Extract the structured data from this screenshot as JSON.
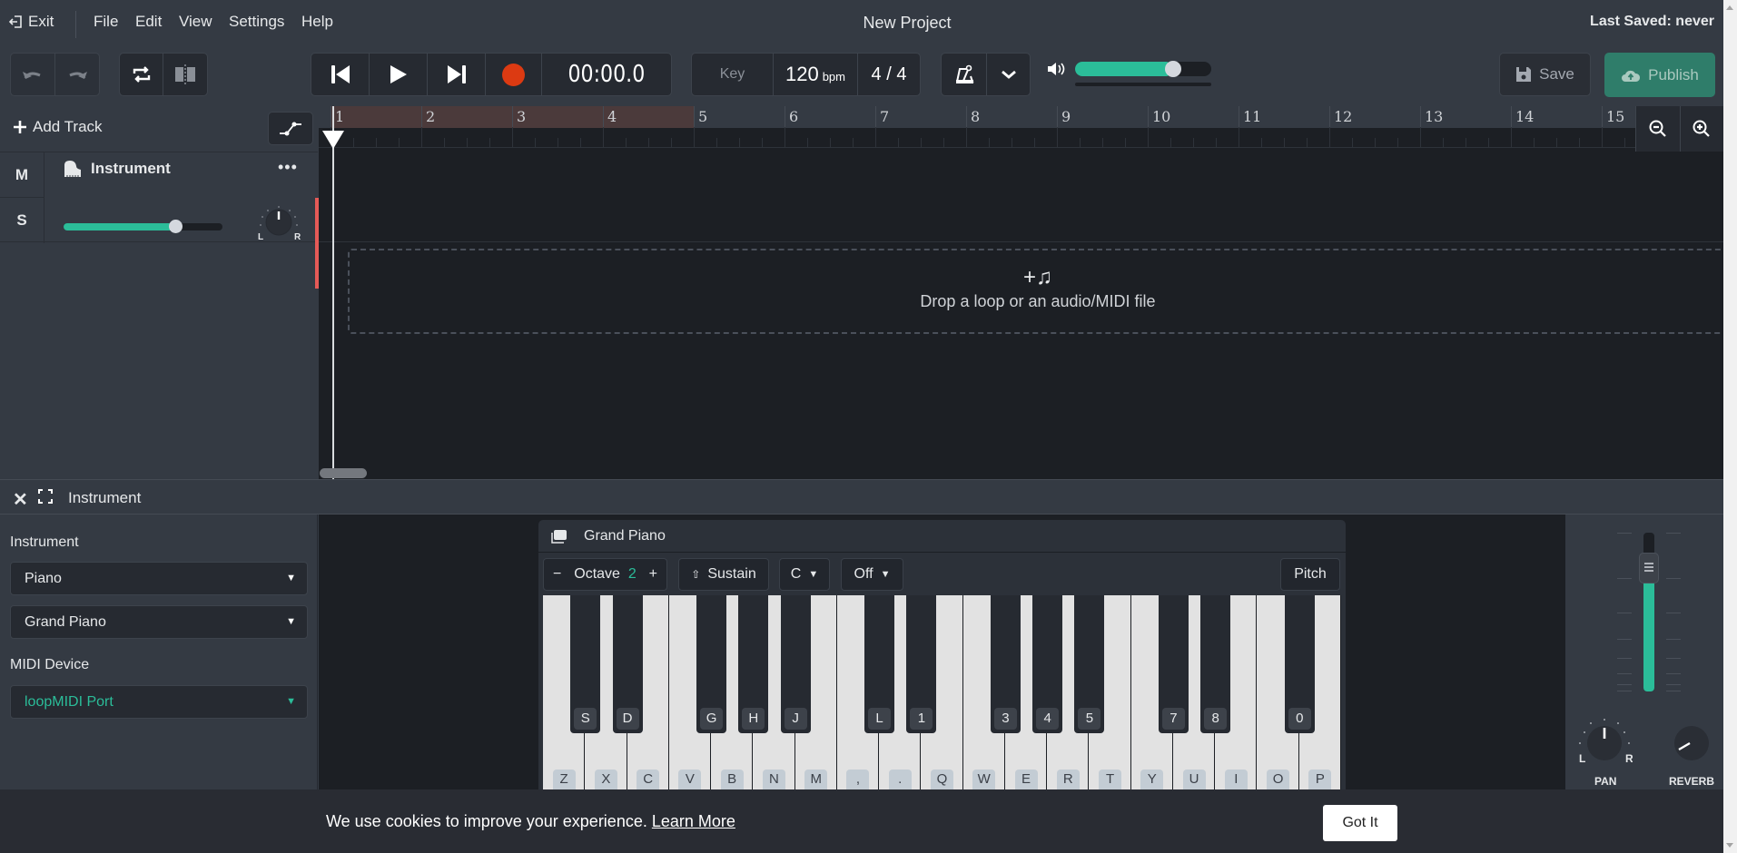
{
  "menu": {
    "exit_label": "Exit",
    "items": [
      "File",
      "Edit",
      "View",
      "Settings",
      "Help"
    ]
  },
  "header": {
    "title": "New Project",
    "last_saved": "Last Saved: never"
  },
  "transport": {
    "timecode": "00:00.0",
    "key_label": "Key",
    "bpm": "120",
    "bpm_unit": "bpm",
    "time_signature": "4 / 4",
    "master_volume": 0.72
  },
  "actions": {
    "save_label": "Save",
    "publish_label": "Publish"
  },
  "tracks_panel": {
    "add_track_label": "Add Track",
    "tracks": [
      {
        "name": "Instrument",
        "mute_label": "M",
        "solo_label": "S",
        "volume": 0.7,
        "pan_l": "L",
        "pan_r": "R"
      }
    ]
  },
  "timeline": {
    "bars": [
      "1",
      "2",
      "3",
      "4",
      "5",
      "6",
      "7",
      "8",
      "9",
      "10",
      "11",
      "12",
      "13",
      "14",
      "15"
    ],
    "loop_range": [
      1,
      4
    ],
    "drop_zone_text": "Drop a loop or an audio/MIDI file"
  },
  "instrument_panel": {
    "title": "Instrument",
    "instrument_label": "Instrument",
    "category_value": "Piano",
    "preset_value": "Grand Piano",
    "midi_label": "MIDI Device",
    "midi_value": "loopMIDI Port"
  },
  "piano": {
    "title": "Grand Piano",
    "octave_label": "Octave",
    "octave_value": "2",
    "octave_minus": "−",
    "octave_plus": "+",
    "sustain_label": "Sustain",
    "key_value": "C",
    "scale_value": "Off",
    "pitch_label": "Pitch",
    "white_keys": [
      "Z",
      "X",
      "C",
      "V",
      "B",
      "N",
      "M",
      ",",
      ".",
      "Q",
      "W",
      "E",
      "R",
      "T",
      "Y",
      "U",
      "I",
      "O",
      "P"
    ],
    "black_keys": [
      {
        "label": "S",
        "after": 0
      },
      {
        "label": "D",
        "after": 1
      },
      {
        "label": "G",
        "after": 3
      },
      {
        "label": "H",
        "after": 4
      },
      {
        "label": "J",
        "after": 5
      },
      {
        "label": "L",
        "after": 7
      },
      {
        "label": "1",
        "after": 8
      },
      {
        "label": "3",
        "after": 10
      },
      {
        "label": "4",
        "after": 11
      },
      {
        "label": "5",
        "after": 12
      },
      {
        "label": "7",
        "after": 14
      },
      {
        "label": "8",
        "after": 15
      },
      {
        "label": "0",
        "after": 17
      }
    ]
  },
  "mixer": {
    "fader_level": 0.78,
    "pan_label": "PAN",
    "pan_l": "L",
    "pan_r": "R",
    "reverb_label": "REVERB"
  },
  "cookie": {
    "message": "We use cookies to improve your experience.",
    "learn_more": "Learn More",
    "accept_label": "Got It"
  },
  "colors": {
    "accent": "#2bbd99",
    "record": "#dc3a12",
    "loop_region": "#4b3a3b",
    "track_color": "#e55a57"
  }
}
